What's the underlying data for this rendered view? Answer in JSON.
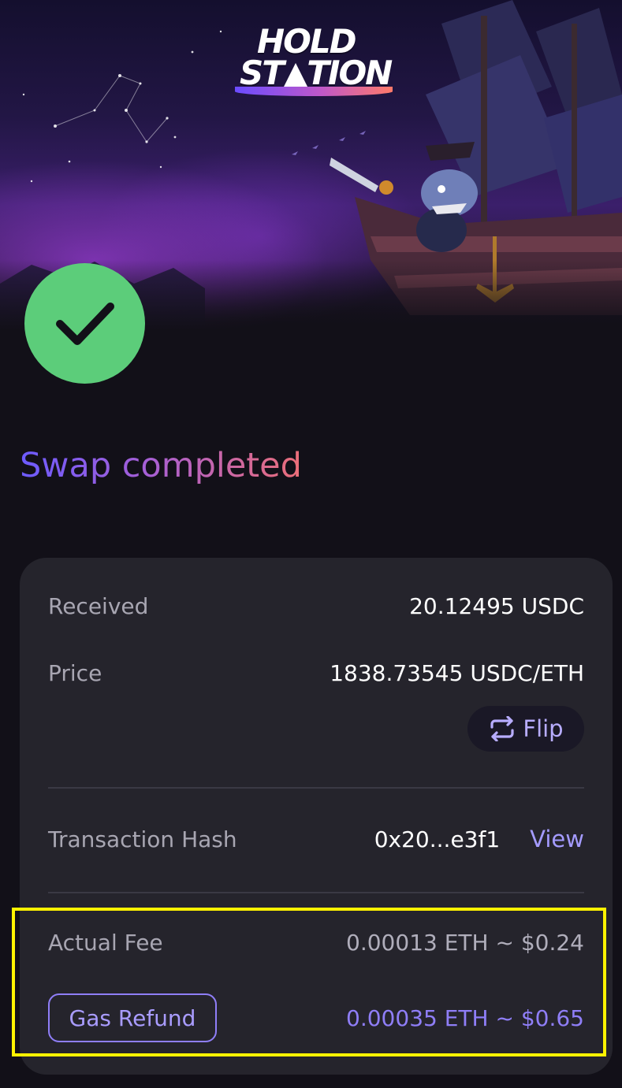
{
  "header": {
    "logo_line1": "HOLD",
    "logo_line2": "ST▲TION"
  },
  "status": {
    "icon": "checkmark-icon",
    "color": "#5ccd7a",
    "title": "Swap completed"
  },
  "details": {
    "received_label": "Received",
    "received_value": "20.12495 USDC",
    "price_label": "Price",
    "price_value": "1838.73545 USDC/ETH",
    "flip_label": "Flip",
    "tx_label": "Transaction Hash",
    "tx_value": "0x20...e3f1",
    "view_label": "View",
    "fee_label": "Actual Fee",
    "fee_value": "0.00013 ETH ~ $0.24",
    "refund_label": "Gas Refund",
    "refund_value": "0.00035 ETH ~ $0.65"
  },
  "colors": {
    "accent": "#8f7ef7",
    "success": "#5ccd7a",
    "highlight": "#fff200",
    "card": "#25242c"
  }
}
